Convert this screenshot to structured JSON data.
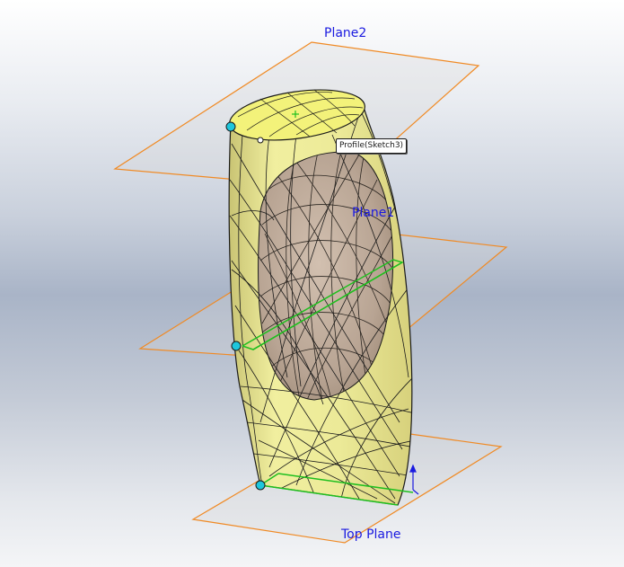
{
  "viewport": {
    "planes": {
      "plane2": "Plane2",
      "plane1": "Plane1",
      "top_plane": "Top Plane"
    },
    "tooltip": {
      "profile": "Profile(Sketch3)"
    }
  },
  "colors": {
    "plane_outline": "#f08a24",
    "plane_fill": "#d8d8d8",
    "body_fill": "#ecec98",
    "body_edge": "#1a1a1a",
    "inner_surface": "#c0ac9c",
    "sketch_line": "#1fbf1f",
    "point_marker": "#1ec6dc",
    "label_text": "#1a1ae0"
  },
  "icons": [
    "sketch-point-icon",
    "origin-plus-icon",
    "triad-arrow-icon"
  ]
}
